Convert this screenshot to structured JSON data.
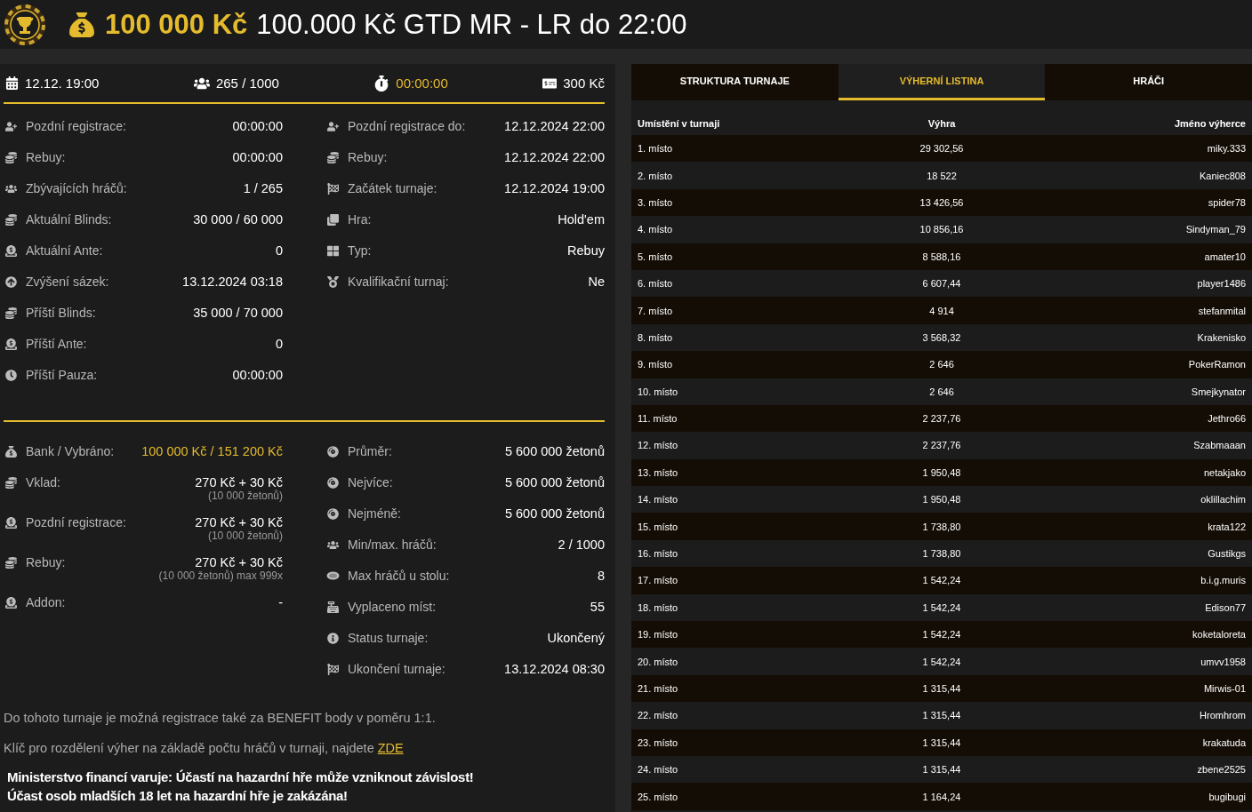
{
  "header": {
    "prize": "100 000 Kč",
    "title": "100.000 Kč GTD MR - LR do 22:00"
  },
  "stats": {
    "start": "12.12. 19:00",
    "players": "265 / 1000",
    "timer": "00:00:00",
    "buyin": "300 Kč"
  },
  "info_left": [
    {
      "label": "Pozdní registrace:",
      "value": "00:00:00"
    },
    {
      "label": "Rebuy:",
      "value": "00:00:00"
    },
    {
      "label": "Zbývajících hráčů:",
      "value": "1 / 265"
    },
    {
      "label": "Aktuální Blinds:",
      "value": "30 000 / 60 000"
    },
    {
      "label": "Aktuální Ante:",
      "value": "0"
    },
    {
      "label": "Zvýšení sázek:",
      "value": "13.12.2024 03:18"
    },
    {
      "label": "Příští Blinds:",
      "value": "35 000 / 70 000"
    },
    {
      "label": "Příští Ante:",
      "value": "0"
    },
    {
      "label": "Příští Pauza:",
      "value": "00:00:00"
    }
  ],
  "info_right": [
    {
      "label": "Pozdní registrace do:",
      "value": "12.12.2024 22:00"
    },
    {
      "label": "Rebuy:",
      "value": "12.12.2024 22:00"
    },
    {
      "label": "Začátek turnaje:",
      "value": "12.12.2024 19:00"
    },
    {
      "label": "Hra:",
      "value": "Hold'em"
    },
    {
      "label": "Typ:",
      "value": "Rebuy"
    },
    {
      "label": "Kvalifikační turnaj:",
      "value": "Ne"
    }
  ],
  "money_left": [
    {
      "label": "Bank / Vybráno:",
      "value": "100 000 Kč / 151 200 Kč",
      "accent": true
    },
    {
      "label": "Vklad:",
      "value": "270 Kč + 30 Kč",
      "note": "(10 000 žetonů)",
      "accent": false
    },
    {
      "label": "Pozdní registrace:",
      "value": "270 Kč + 30 Kč",
      "note": "(10 000 žetonů)",
      "accent": false
    },
    {
      "label": "Rebuy:",
      "value": "270 Kč + 30 Kč",
      "note": "(10 000 žetonů) max 999x",
      "accent": false
    },
    {
      "label": "Addon:",
      "value": "-",
      "accent": false
    }
  ],
  "money_right": [
    {
      "label": "Průměr:",
      "value": "5 600 000 žetonů"
    },
    {
      "label": "Nejvíce:",
      "value": "5 600 000 žetonů"
    },
    {
      "label": "Nejméně:",
      "value": "5 600 000 žetonů"
    },
    {
      "label": "Min/max. hráčů:",
      "value": "2 / 1000"
    },
    {
      "label": "Max hráčů u stolu:",
      "value": "8"
    },
    {
      "label": "Vyplaceno míst:",
      "value": "55"
    },
    {
      "label": "Status turnaje:",
      "value": "Ukončený"
    },
    {
      "label": "Ukončení turnaje:",
      "value": "13.12.2024 08:30"
    }
  ],
  "notes": {
    "benefit": "Do tohoto turnaje je možná registrace také za BENEFIT body v poměru 1:1.",
    "key_text": "Klíč pro rozdělení výher na základě počtu hráčů v turnaji, najdete",
    "key_link": "ZDE"
  },
  "warning": [
    "Ministerstvo financí varuje: Účastí na hazardní hře může vzniknout závislost!",
    "Účast osob mladších 18 let na hazardní hře je zakázána!"
  ],
  "tabs": [
    {
      "label": "STRUKTURA TURNAJE",
      "selected": false
    },
    {
      "label": "VÝHERNÍ LISTINA",
      "selected": true
    },
    {
      "label": "HRÁČI",
      "selected": false
    }
  ],
  "table": {
    "columns": [
      "Umístění v turnaji",
      "Výhra",
      "Jméno výherce"
    ],
    "rows": [
      [
        "1. místo",
        "29 302,56",
        "miky.333"
      ],
      [
        "2. místo",
        "18 522",
        "Kaniec808"
      ],
      [
        "3. místo",
        "13 426,56",
        "spider78"
      ],
      [
        "4. místo",
        "10 856,16",
        "Sindyman_79"
      ],
      [
        "5. místo",
        "8 588,16",
        "amater10"
      ],
      [
        "6. místo",
        "6 607,44",
        "player1486"
      ],
      [
        "7. místo",
        "4 914",
        "stefanmital"
      ],
      [
        "8. místo",
        "3 568,32",
        "Krakenisko"
      ],
      [
        "9. místo",
        "2 646",
        "PokerRamon"
      ],
      [
        "10. místo",
        "2 646",
        "Smejkynator"
      ],
      [
        "11. místo",
        "2 237,76",
        "Jethro66"
      ],
      [
        "12. místo",
        "2 237,76",
        "Szabmaaan"
      ],
      [
        "13. místo",
        "1 950,48",
        "netakjako"
      ],
      [
        "14. místo",
        "1 950,48",
        "oklillachim"
      ],
      [
        "15. místo",
        "1 738,80",
        "krata122"
      ],
      [
        "16. místo",
        "1 738,80",
        "Gustikgs"
      ],
      [
        "17. místo",
        "1 542,24",
        "b.i.g.muris"
      ],
      [
        "18. místo",
        "1 542,24",
        "Edison77"
      ],
      [
        "19. místo",
        "1 542,24",
        "koketaloreta"
      ],
      [
        "20. místo",
        "1 542,24",
        "umvv1958"
      ],
      [
        "21. místo",
        "1 315,44",
        "Mirwis-01"
      ],
      [
        "22. místo",
        "1 315,44",
        "Hromhrom"
      ],
      [
        "23. místo",
        "1 315,44",
        "krakatuda"
      ],
      [
        "24. místo",
        "1 315,44",
        "zbene2525"
      ],
      [
        "25. místo",
        "1 164,24",
        "bugibugi"
      ]
    ]
  }
}
